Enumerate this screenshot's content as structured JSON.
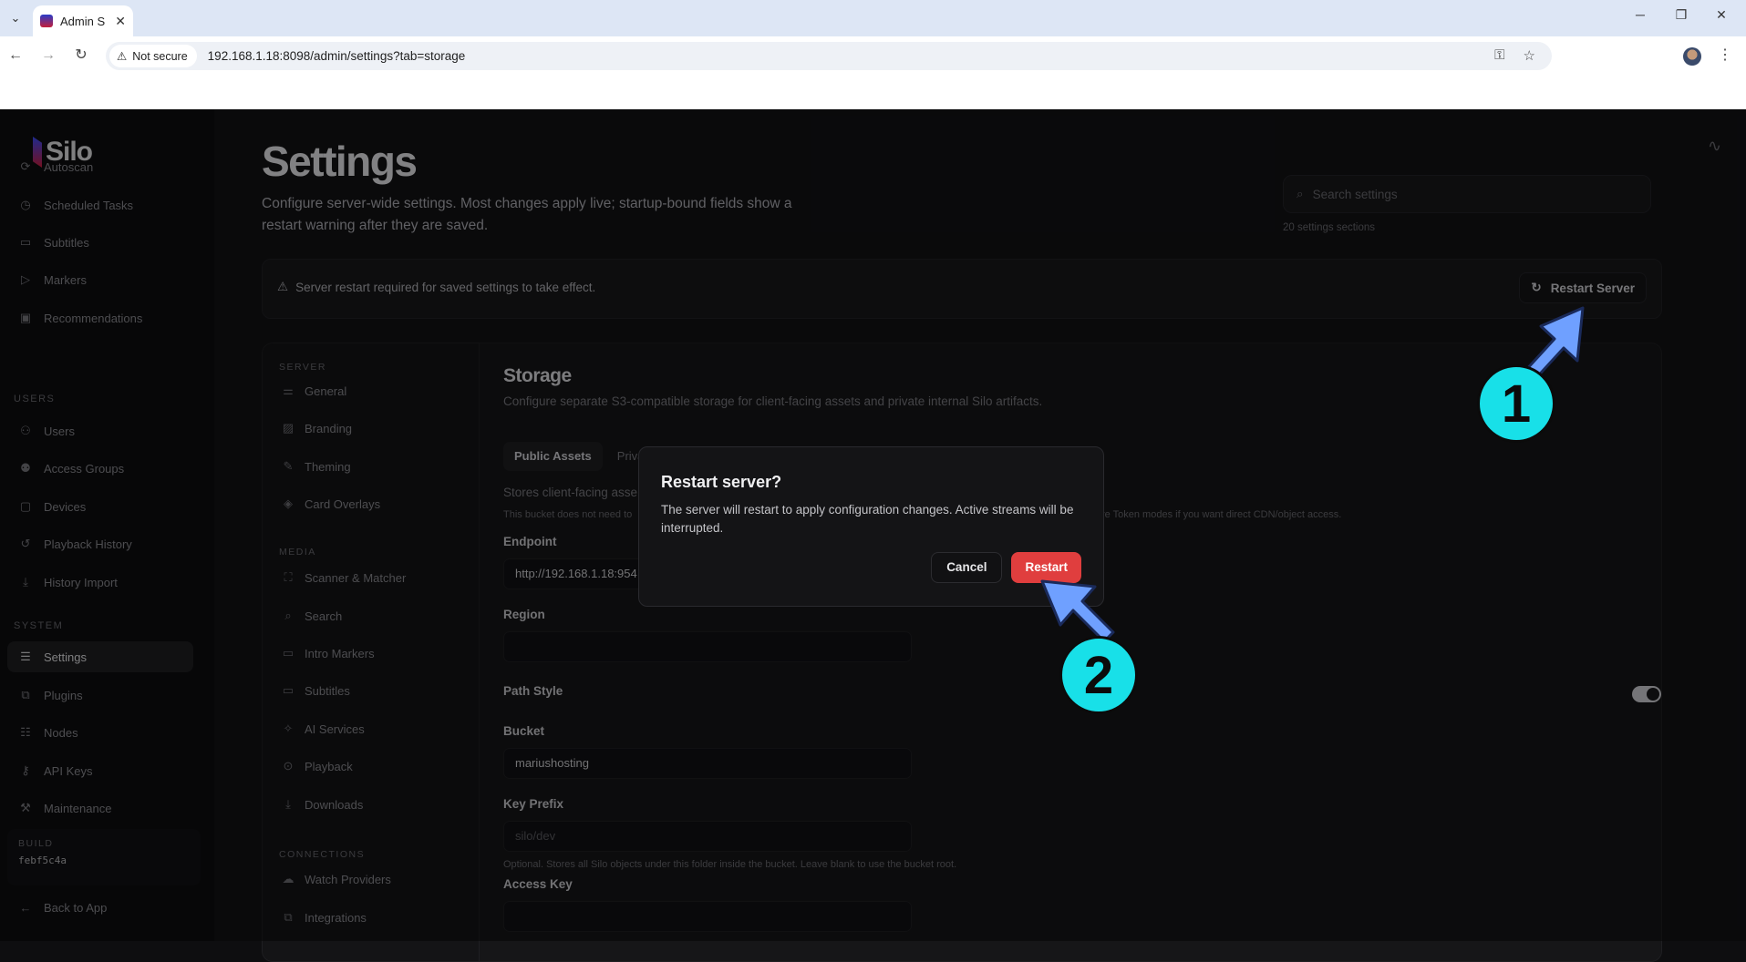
{
  "browser": {
    "tab_title": "Admin S",
    "security_label": "Not secure",
    "url": "192.168.1.18:8098/admin/settings?tab=storage"
  },
  "sidebar": {
    "logo": "Silo",
    "items_top": [
      {
        "label": "Autoscan",
        "icon": "autoscan-icon"
      },
      {
        "label": "Scheduled Tasks",
        "icon": "clock-icon"
      },
      {
        "label": "Subtitles",
        "icon": "subtitles-icon"
      },
      {
        "label": "Markers",
        "icon": "markers-icon"
      },
      {
        "label": "Recommendations",
        "icon": "recommendations-icon"
      }
    ],
    "section_users": "USERS",
    "items_users": [
      {
        "label": "Users",
        "icon": "users-icon"
      },
      {
        "label": "Access Groups",
        "icon": "access-groups-icon"
      },
      {
        "label": "Devices",
        "icon": "devices-icon"
      },
      {
        "label": "Playback History",
        "icon": "history-icon"
      },
      {
        "label": "History Import",
        "icon": "import-icon"
      }
    ],
    "section_system": "SYSTEM",
    "items_system": [
      {
        "label": "Settings",
        "icon": "sliders-icon"
      },
      {
        "label": "Plugins",
        "icon": "plugins-icon"
      },
      {
        "label": "Nodes",
        "icon": "nodes-icon"
      },
      {
        "label": "API Keys",
        "icon": "key-icon"
      },
      {
        "label": "Maintenance",
        "icon": "wrench-icon"
      }
    ],
    "build_label": "BUILD",
    "build_hash": "febf5c4a",
    "back_label": "Back to App"
  },
  "header": {
    "title": "Settings",
    "description": "Configure server-wide settings. Most changes apply live; startup-bound fields show a restart warning after they are saved.",
    "search_placeholder": "Search settings",
    "sections_count": "20 settings sections"
  },
  "banner": {
    "message": "Server restart required for saved settings to take effect.",
    "button_label": "Restart Server"
  },
  "settings_nav": {
    "server_section": "SERVER",
    "server_items": [
      "General",
      "Branding",
      "Theming",
      "Card Overlays"
    ],
    "media_section": "MEDIA",
    "media_items": [
      "Scanner & Matcher",
      "Search",
      "Intro Markers",
      "Subtitles",
      "AI Services",
      "Playback",
      "Downloads"
    ],
    "connections_section": "CONNECTIONS",
    "connections_items": [
      "Watch Providers",
      "Integrations"
    ]
  },
  "storage": {
    "title": "Storage",
    "description": "Configure separate S3-compatible storage for client-facing assets and private internal Silo artifacts.",
    "tabs": [
      "Public Assets",
      "Priva"
    ],
    "bucket_desc": "Stores client-facing asse",
    "bucket_note_left": "This bucket does not need to",
    "bucket_note_right": "re Token modes if you want direct CDN/object access.",
    "endpoint_label": "Endpoint",
    "endpoint_value": "http://192.168.1.18:954",
    "region_label": "Region",
    "region_value": "",
    "path_style_label": "Path Style",
    "path_style_on": true,
    "bucket_label": "Bucket",
    "bucket_value": "mariushosting",
    "key_prefix_label": "Key Prefix",
    "key_prefix_placeholder": "silo/dev",
    "key_prefix_help": "Optional. Stores all Silo objects under this folder inside the bucket. Leave blank to use the bucket root.",
    "access_key_label": "Access Key"
  },
  "dialog": {
    "title": "Restart server?",
    "message": "The server will restart to apply configuration changes. Active streams will be interrupted.",
    "cancel_label": "Cancel",
    "confirm_label": "Restart"
  },
  "annotations": {
    "step1": "1",
    "step2": "2",
    "accent": "#18e0e8",
    "arrow_color": "#6fa0ff"
  }
}
